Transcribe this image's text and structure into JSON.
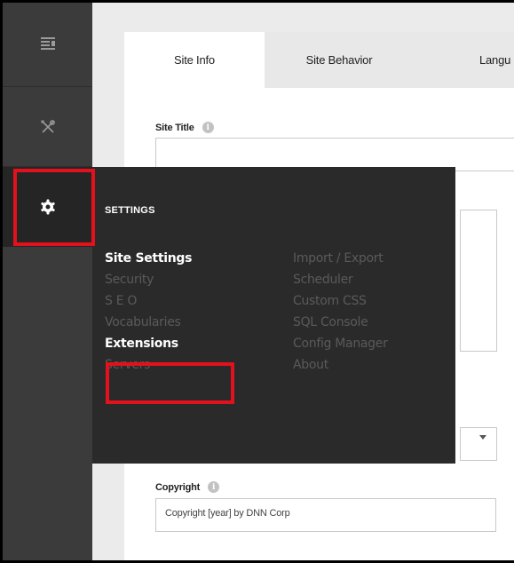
{
  "sidebar": {
    "items": [
      {
        "icon": "content-list-icon"
      },
      {
        "icon": "tools-icon"
      },
      {
        "icon": "gear-icon"
      }
    ]
  },
  "tabs": [
    {
      "label": "Site Info"
    },
    {
      "label": "Site Behavior"
    },
    {
      "label": "Langu"
    }
  ],
  "form": {
    "site_title_label": "Site Title",
    "site_title_value": "",
    "copyright_label": "Copyright",
    "copyright_value": "Copyright [year] by DNN Corp"
  },
  "settings_menu": {
    "title": "SETTINGS",
    "left_items": [
      "Site Settings",
      "Security",
      "S E O",
      "Vocabularies",
      "Extensions",
      "Servers"
    ],
    "right_items": [
      "Import / Export",
      "Scheduler",
      "Custom CSS",
      "SQL Console",
      "Config Manager",
      "About"
    ],
    "active_item": "Site Settings"
  },
  "colors": {
    "sidebar_bg": "#3b3b3b",
    "menu_bg": "#2a2a2a",
    "highlight_red": "#e3111b"
  }
}
